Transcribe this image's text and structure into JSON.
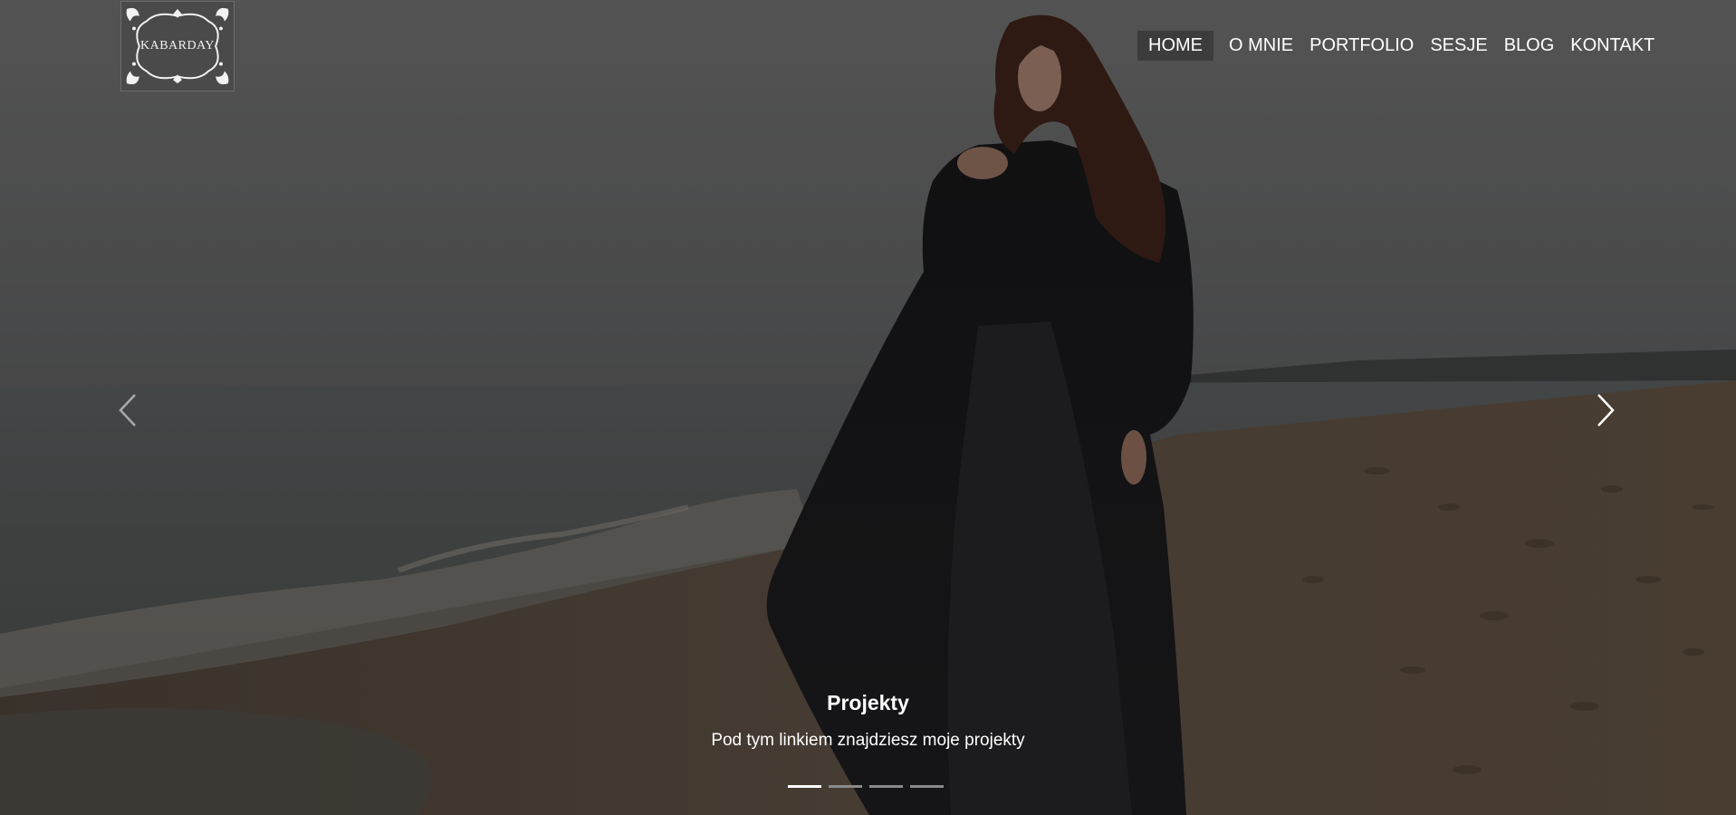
{
  "logo": {
    "text": "KABARDAY"
  },
  "nav": {
    "items": [
      {
        "label": "HOME",
        "active": true
      },
      {
        "label": "O MNIE",
        "active": false
      },
      {
        "label": "PORTFOLIO",
        "active": false
      },
      {
        "label": "SESJE",
        "active": false
      },
      {
        "label": "BLOG",
        "active": false
      },
      {
        "label": "KONTAKT",
        "active": false
      }
    ]
  },
  "carousel": {
    "prev_icon": "chevron-left-icon",
    "next_icon": "chevron-right-icon",
    "slide": {
      "title": "Projekty",
      "text": "Pod tym linkiem znajdziesz moje projekty"
    },
    "slide_count": 4,
    "active_index": 0
  },
  "colors": {
    "overlay": "#2b2b2b",
    "nav_active_bg": "#3c3c3c",
    "text": "#ffffff"
  }
}
